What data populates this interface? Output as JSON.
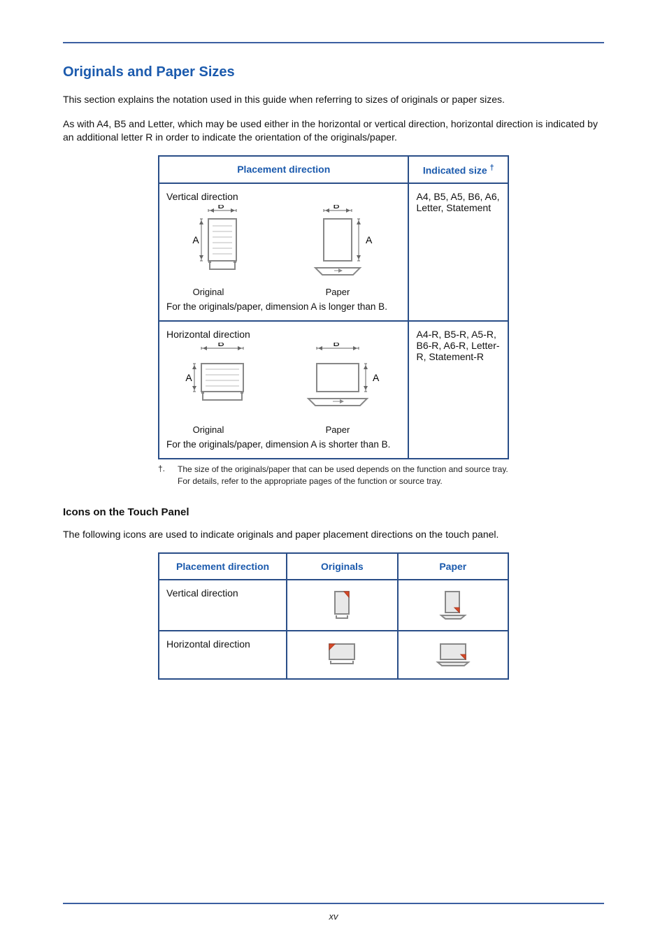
{
  "page": {
    "number": "xv",
    "heading": "Originals and Paper Sizes",
    "intro1": "This section explains the notation used in this guide when referring to sizes of originals or paper sizes.",
    "intro2": "As with A4, B5 and Letter, which may be used either in the horizontal or vertical direction, horizontal direction is indicated by an additional letter R in order to indicate the orientation of the originals/paper."
  },
  "table1": {
    "headers": {
      "placement": "Placement direction",
      "indicated": "Indicated size",
      "indicated_dagger": "†"
    },
    "rows": [
      {
        "direction": "Vertical direction",
        "diag_labels": {
          "A": "A",
          "B": "B",
          "original": "Original",
          "paper": "Paper"
        },
        "note": "For the originals/paper, dimension A is longer than B.",
        "sizes": "A4, B5, A5, B6, A6, Letter, Statement"
      },
      {
        "direction": "Horizontal direction",
        "diag_labels": {
          "A": "A",
          "B": "B",
          "original": "Original",
          "paper": "Paper"
        },
        "note": "For the originals/paper, dimension A is shorter than B.",
        "sizes": "A4-R, B5-R, A5-R, B6-R, A6-R, Letter-R, Statement-R"
      }
    ],
    "footnote": {
      "mark": "†.",
      "text": "The size of the originals/paper that can be used depends on the function and source tray. For details, refer to the appropriate pages of the function or source tray."
    }
  },
  "section2": {
    "heading": "Icons on the Touch Panel",
    "intro": "The following icons are used to indicate originals and paper placement directions on the touch panel.",
    "headers": {
      "placement": "Placement direction",
      "originals": "Originals",
      "paper": "Paper"
    },
    "rows": [
      {
        "direction": "Vertical direction"
      },
      {
        "direction": "Horizontal direction"
      }
    ]
  }
}
